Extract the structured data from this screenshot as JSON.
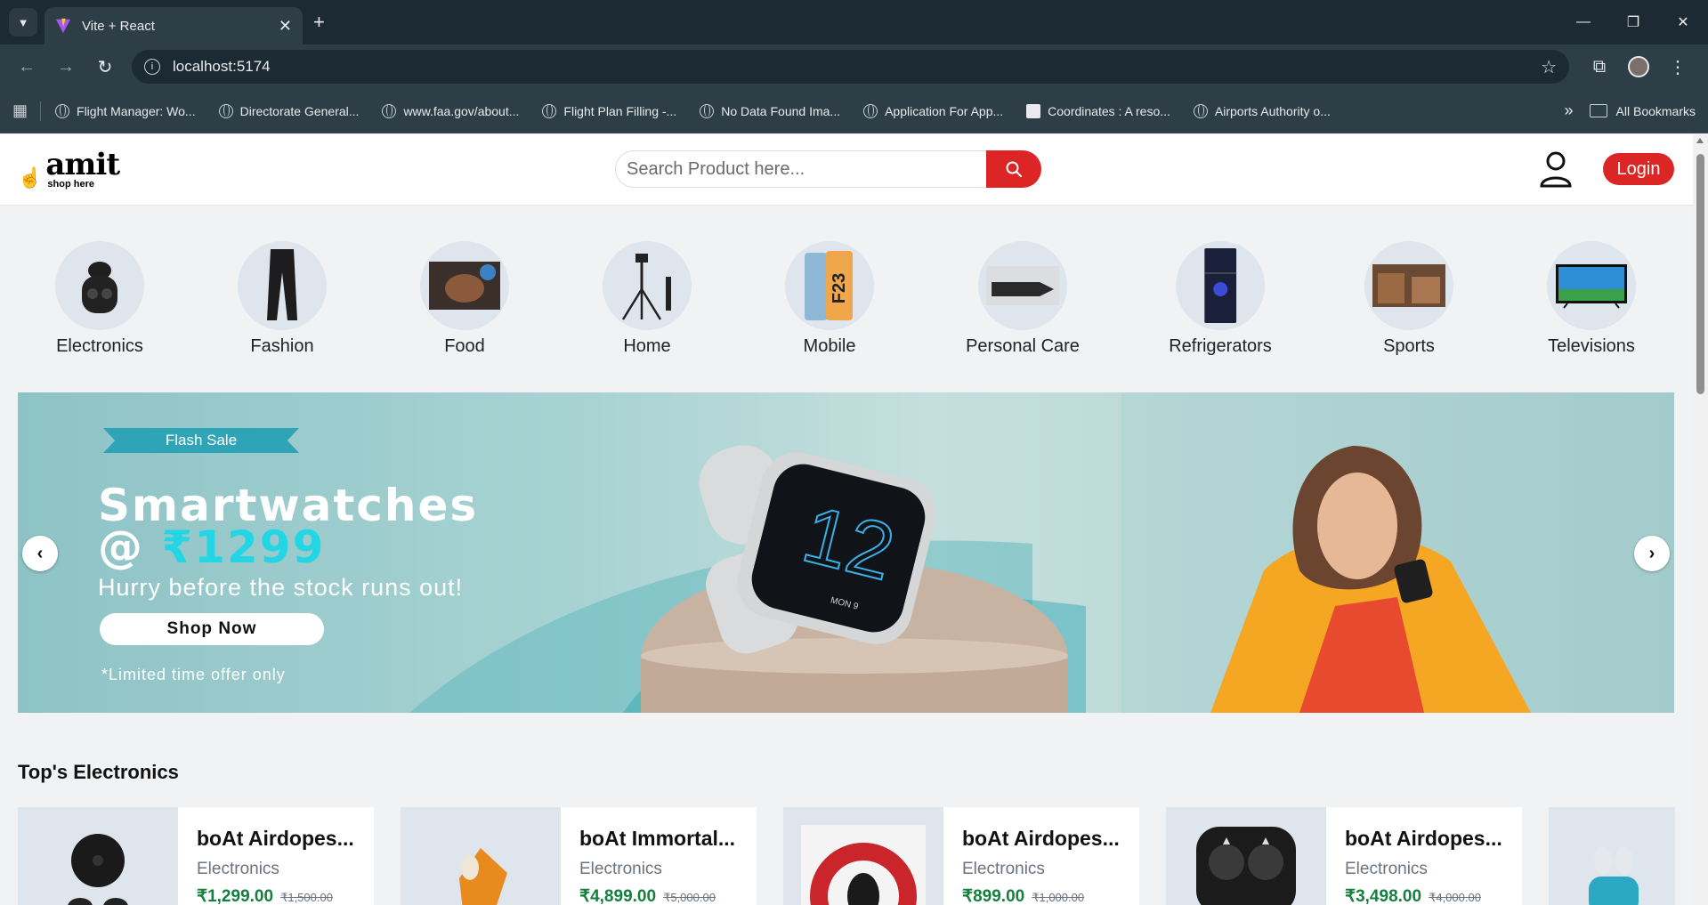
{
  "browser": {
    "tab_title": "Vite + React",
    "url": "localhost:5174",
    "bookmarks": [
      {
        "label": "Flight Manager: Wo..."
      },
      {
        "label": "Directorate General..."
      },
      {
        "label": "www.faa.gov/about..."
      },
      {
        "label": "Flight Plan Filling -..."
      },
      {
        "label": "No Data Found Ima..."
      },
      {
        "label": "Application For App..."
      },
      {
        "label": "Coordinates : A reso..."
      },
      {
        "label": "Airports Authority o..."
      }
    ],
    "all_bookmarks": "All Bookmarks"
  },
  "header": {
    "logo_brand": "amit",
    "logo_tagline": "shop here",
    "search_placeholder": "Search Product here...",
    "login_label": "Login"
  },
  "categories": [
    {
      "label": "Electronics"
    },
    {
      "label": "Fashion"
    },
    {
      "label": "Food"
    },
    {
      "label": "Home"
    },
    {
      "label": "Mobile"
    },
    {
      "label": "Personal Care"
    },
    {
      "label": "Refrigerators"
    },
    {
      "label": "Sports"
    },
    {
      "label": "Televisions"
    }
  ],
  "banner": {
    "tag": "Flash Sale",
    "title": "Smartwatches",
    "price_prefix": "@ ",
    "price": "₹1299",
    "subtitle": "Hurry before the stock runs out!",
    "button": "Shop Now",
    "note": "*Limited time offer only",
    "watch_time": "12",
    "watch_date": "MON 9"
  },
  "section": {
    "title": "Top's Electronics"
  },
  "products": [
    {
      "name": "boAt Airdopes...",
      "category": "Electronics",
      "price": "₹1,299.00",
      "old_price": "₹1,500.00"
    },
    {
      "name": "boAt Immortal...",
      "category": "Electronics",
      "price": "₹4,899.00",
      "old_price": "₹5,000.00"
    },
    {
      "name": "boAt Airdopes...",
      "category": "Electronics",
      "price": "₹899.00",
      "old_price": "₹1,000.00"
    },
    {
      "name": "boAt Airdopes...",
      "category": "Electronics",
      "price": "₹3,498.00",
      "old_price": "₹4,000.00"
    }
  ],
  "colors": {
    "accent": "#dc2626",
    "price_green": "#15803d",
    "banner_accent": "#23d6e6"
  }
}
